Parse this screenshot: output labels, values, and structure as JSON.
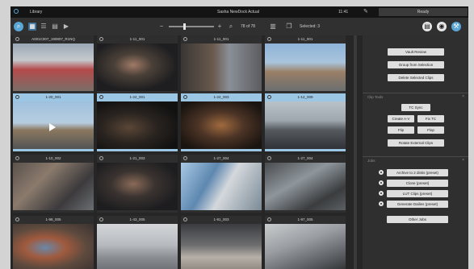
{
  "window": {
    "library_label": "Library",
    "title": "Sasha NewDock Actual",
    "clock": "11:41",
    "status": "Ready"
  },
  "toolbar": {
    "zoom_value": "78 of 78",
    "selected_count": "Selected: 3"
  },
  "grid": {
    "tiles": [
      {
        "label": "A001C007_190807_R1NQ",
        "selected": false
      },
      {
        "label": "1-11_001",
        "selected": false
      },
      {
        "label": "1-11_001",
        "selected": false
      },
      {
        "label": "1-11_001",
        "selected": false
      },
      {
        "label": "1-20_001",
        "selected": true
      },
      {
        "label": "1-24_001",
        "selected": true
      },
      {
        "label": "1-24_003",
        "selected": true
      },
      {
        "label": "1-14_009",
        "selected": true
      },
      {
        "label": "1-10_002",
        "selected": false
      },
      {
        "label": "1-21_003",
        "selected": false
      },
      {
        "label": "1-27_004",
        "selected": false
      },
      {
        "label": "1-27_004",
        "selected": false
      },
      {
        "label": "1-98_005",
        "selected": false
      },
      {
        "label": "1-43_005",
        "selected": false
      },
      {
        "label": "1-91_003",
        "selected": false
      },
      {
        "label": "1-97_005",
        "selected": false
      }
    ]
  },
  "panel": {
    "top_buttons": [
      "Vault Review",
      "Group from Selection",
      "Delete Selected Clips"
    ],
    "clip_tools": {
      "header": "Clip Tools",
      "buttons": [
        "TC Sync",
        "Create A-V",
        "Fix TC",
        "Flip",
        "Flop",
        "Rotate External Clips"
      ]
    },
    "jobs": {
      "header": "Jobs",
      "items": [
        "Archive to 2 disks (preset)",
        "Clone (preset)",
        "LUT Clips (preset)",
        "Generate Dailies (preset)"
      ],
      "other_button": "Other Jobs"
    }
  },
  "colors": {
    "accent": "#5aa7d6",
    "selected_tile": "#9bc6e4",
    "background": "#262626"
  }
}
